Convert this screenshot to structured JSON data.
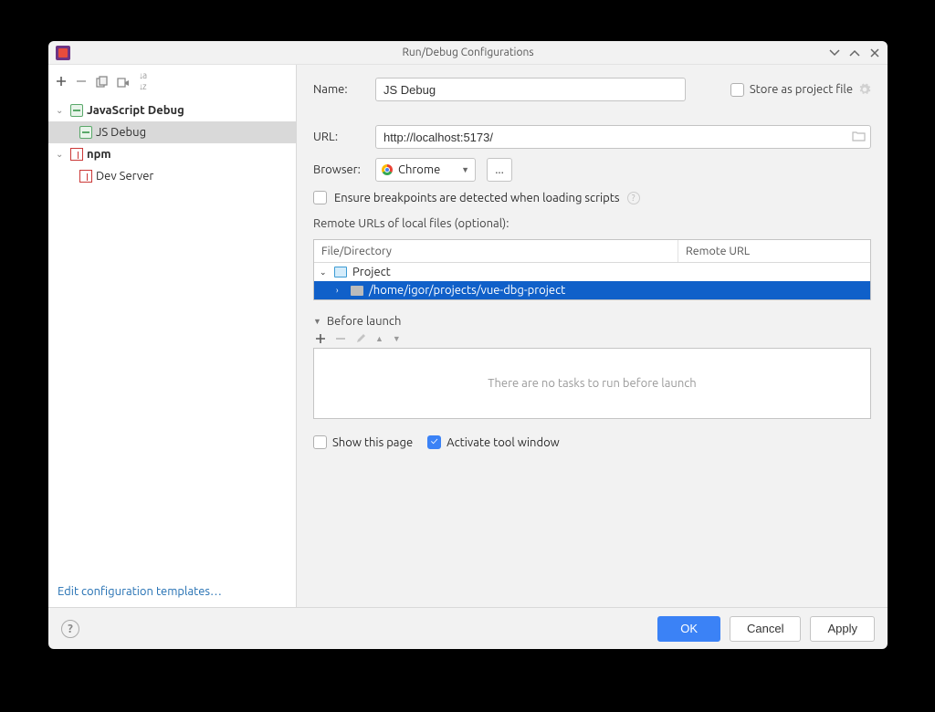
{
  "window": {
    "title": "Run/Debug Configurations"
  },
  "sidebar": {
    "groups": [
      {
        "name": "JavaScript Debug",
        "children": [
          "JS Debug"
        ]
      },
      {
        "name": "npm",
        "children": [
          "Dev Server"
        ]
      }
    ],
    "footer_link": "Edit configuration templates…"
  },
  "form": {
    "name_label": "Name:",
    "name_value": "JS Debug",
    "store_label": "Store as project file",
    "url_label": "URL:",
    "url_value": "http://localhost:5173/",
    "browser_label": "Browser:",
    "browser_value": "Chrome",
    "more_btn": "...",
    "ensure_label": "Ensure breakpoints are detected when loading scripts",
    "remote_label": "Remote URLs of local files (optional):",
    "grid": {
      "col1": "File/Directory",
      "col2": "Remote URL",
      "project_label": "Project",
      "path": "/home/igor/projects/vue-dbg-project"
    },
    "before": {
      "title": "Before launch",
      "empty": "There are no tasks to run before launch"
    },
    "show_page": "Show this page",
    "activate": "Activate tool window"
  },
  "buttons": {
    "ok": "OK",
    "cancel": "Cancel",
    "apply": "Apply"
  }
}
